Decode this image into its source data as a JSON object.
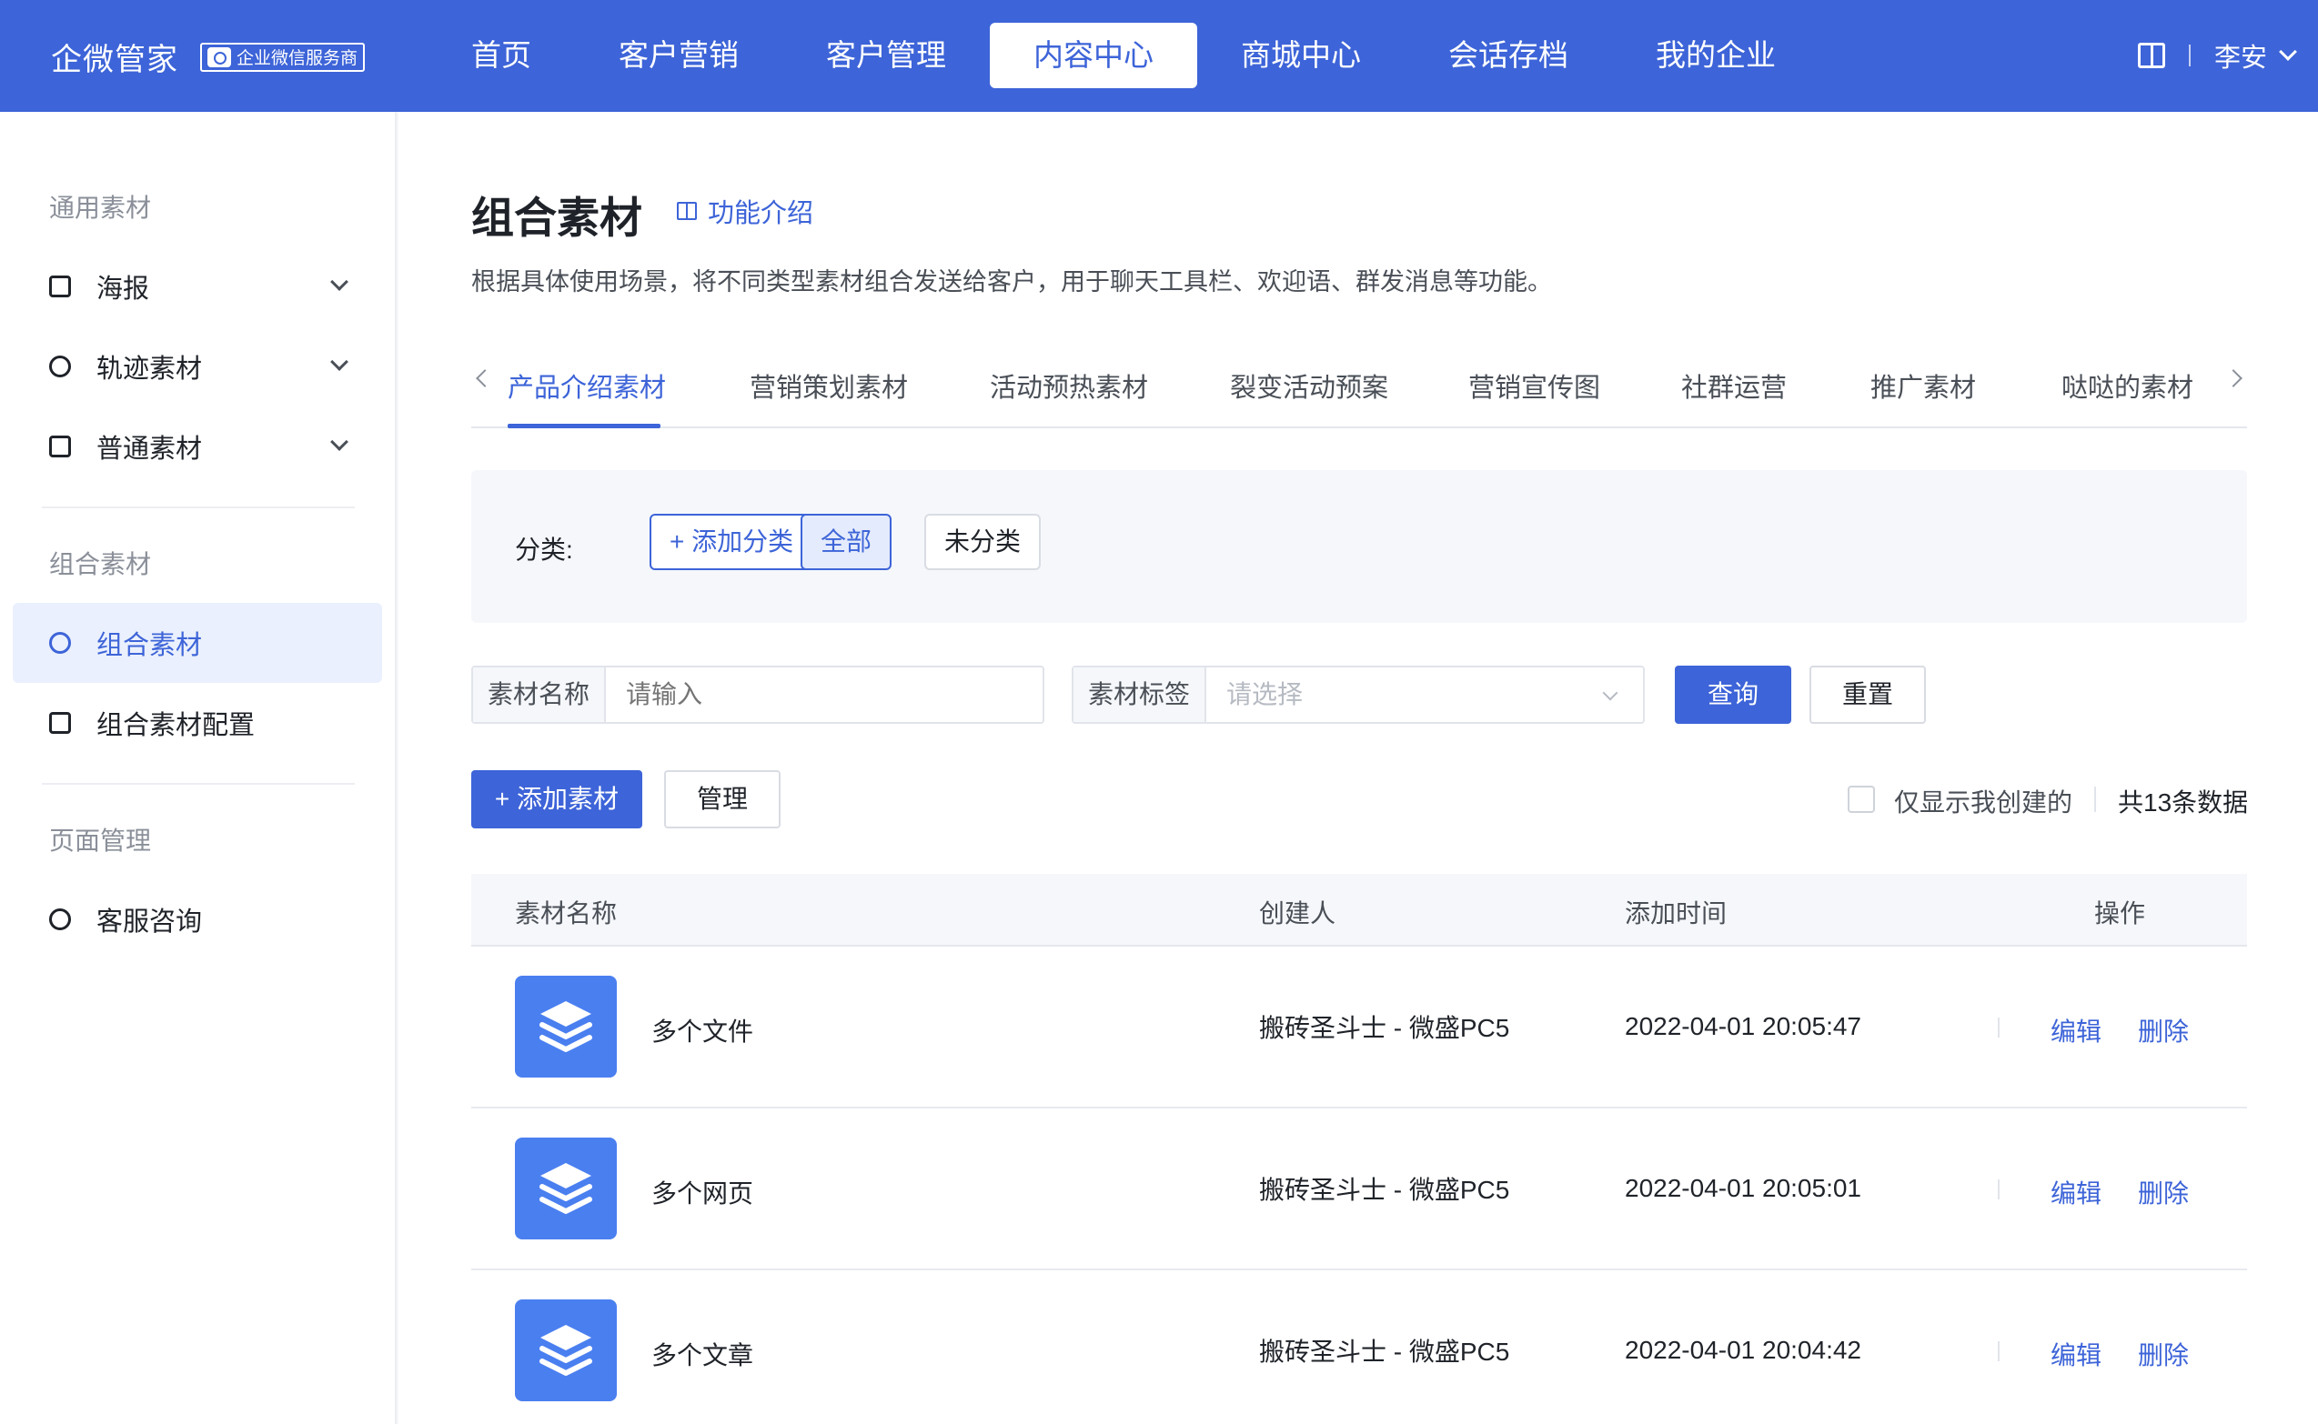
{
  "header": {
    "brand_name": "企微管家",
    "brand_badge": "企业微信服务商",
    "nav": [
      "首页",
      "客户营销",
      "客户管理",
      "内容中心",
      "商城中心",
      "会话存档",
      "我的企业"
    ],
    "active_nav": "内容中心",
    "user_name": "李安"
  },
  "sidebar": {
    "group1": "通用素材",
    "items1": [
      "海报",
      "轨迹素材",
      "普通素材"
    ],
    "group2": "组合素材",
    "items2": [
      "组合素材",
      "组合素材配置"
    ],
    "group3": "页面管理",
    "items3": [
      "客服咨询"
    ]
  },
  "main": {
    "title": "组合素材",
    "intro_link": "功能介绍",
    "description": "根据具体使用场景，将不同类型素材组合发送给客户，用于聊天工具栏、欢迎语、群发消息等功能。",
    "tabs": [
      "产品介绍素材",
      "营销策划素材",
      "活动预热素材",
      "裂变活动预案",
      "营销宣传图",
      "社群运营",
      "推广素材",
      "哒哒的素材"
    ],
    "category_label": "分类:",
    "add_category": "+ 添加分类",
    "category_all": "全部",
    "category_uncat": "未分类",
    "filter_name_label": "素材名称",
    "filter_name_placeholder": "请输入",
    "filter_tag_label": "素材标签",
    "filter_tag_placeholder": "请选择",
    "query": "查询",
    "reset": "重置",
    "add_material": "+ 添加素材",
    "manage": "管理",
    "only_mine": "仅显示我创建的",
    "total": "共13条数据",
    "columns": [
      "素材名称",
      "创建人",
      "添加时间",
      "操作"
    ],
    "rows": [
      {
        "name": "多个文件",
        "creator": "搬砖圣斗士 - 微盛PC5",
        "time": "2022-04-01 20:05:47",
        "edit": "编辑",
        "delete": "删除"
      },
      {
        "name": "多个网页",
        "creator": "搬砖圣斗士 - 微盛PC5",
        "time": "2022-04-01 20:05:01",
        "edit": "编辑",
        "delete": "删除"
      },
      {
        "name": "多个文章",
        "creator": "搬砖圣斗士 - 微盛PC5",
        "time": "2022-04-01 20:04:42",
        "edit": "编辑",
        "delete": "删除"
      }
    ]
  },
  "colors": {
    "primary": "#3d64d8",
    "thumb": "#4a7ff0"
  }
}
